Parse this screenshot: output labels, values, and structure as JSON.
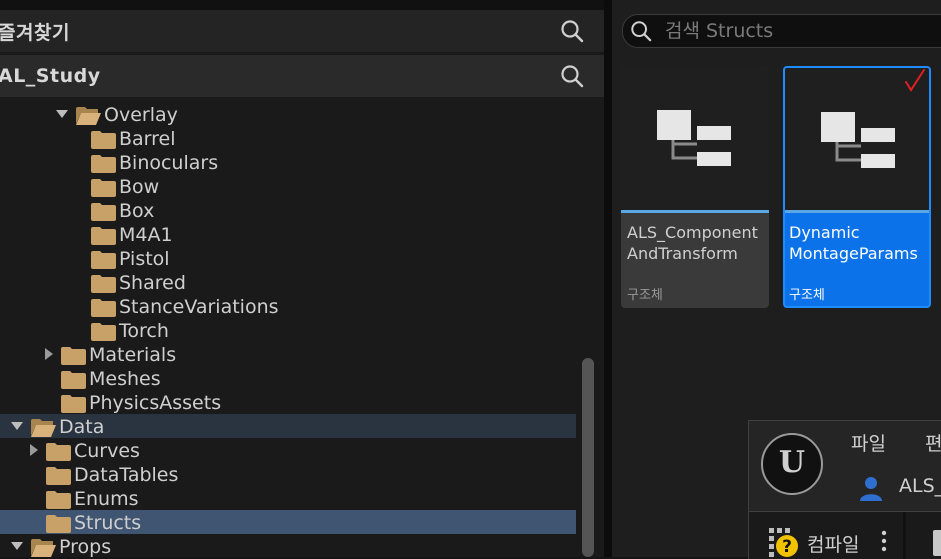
{
  "left_panel": {
    "favorites_title": "즐겨찾기",
    "project_title": "AL_Study",
    "tree": [
      {
        "label": "Overlay",
        "arrow": "down",
        "open": true,
        "indent": 76
      },
      {
        "label": "Barrel",
        "arrow": "none",
        "open": false,
        "indent": 91
      },
      {
        "label": "Binoculars",
        "arrow": "none",
        "open": false,
        "indent": 91
      },
      {
        "label": "Bow",
        "arrow": "none",
        "open": false,
        "indent": 91
      },
      {
        "label": "Box",
        "arrow": "none",
        "open": false,
        "indent": 91
      },
      {
        "label": "M4A1",
        "arrow": "none",
        "open": false,
        "indent": 91
      },
      {
        "label": "Pistol",
        "arrow": "none",
        "open": false,
        "indent": 91
      },
      {
        "label": "Shared",
        "arrow": "none",
        "open": false,
        "indent": 91
      },
      {
        "label": "StanceVariations",
        "arrow": "none",
        "open": false,
        "indent": 91
      },
      {
        "label": "Torch",
        "arrow": "none",
        "open": false,
        "indent": 91
      },
      {
        "label": "Materials",
        "arrow": "right",
        "open": false,
        "indent": 61
      },
      {
        "label": "Meshes",
        "arrow": "none",
        "open": false,
        "indent": 61
      },
      {
        "label": "PhysicsAssets",
        "arrow": "none",
        "open": false,
        "indent": 61
      },
      {
        "label": "Data",
        "arrow": "down",
        "open": true,
        "indent": 31,
        "state": "selected-dark"
      },
      {
        "label": "Curves",
        "arrow": "right",
        "open": false,
        "indent": 46
      },
      {
        "label": "DataTables",
        "arrow": "none",
        "open": false,
        "indent": 46
      },
      {
        "label": "Enums",
        "arrow": "none",
        "open": false,
        "indent": 46
      },
      {
        "label": "Structs",
        "arrow": "none",
        "open": false,
        "indent": 46,
        "state": "selected"
      },
      {
        "label": "Props",
        "arrow": "down",
        "open": true,
        "indent": 31
      }
    ]
  },
  "right_panel": {
    "search_placeholder": "검색 Structs",
    "assets": [
      {
        "name": "ALS_Component\nAndTransform",
        "type": "구조체",
        "selected": false
      },
      {
        "name": "Dynamic\nMontageParams",
        "type": "구조체",
        "selected": true
      }
    ]
  },
  "blueprint_window": {
    "logo": "U",
    "menu": [
      "파일",
      "편"
    ],
    "asset_name": "ALS_",
    "compile_label": "컴파일"
  },
  "colors": {
    "accent": "#0c72ea",
    "selection": "#3f5572",
    "folder": "#c8a169"
  }
}
